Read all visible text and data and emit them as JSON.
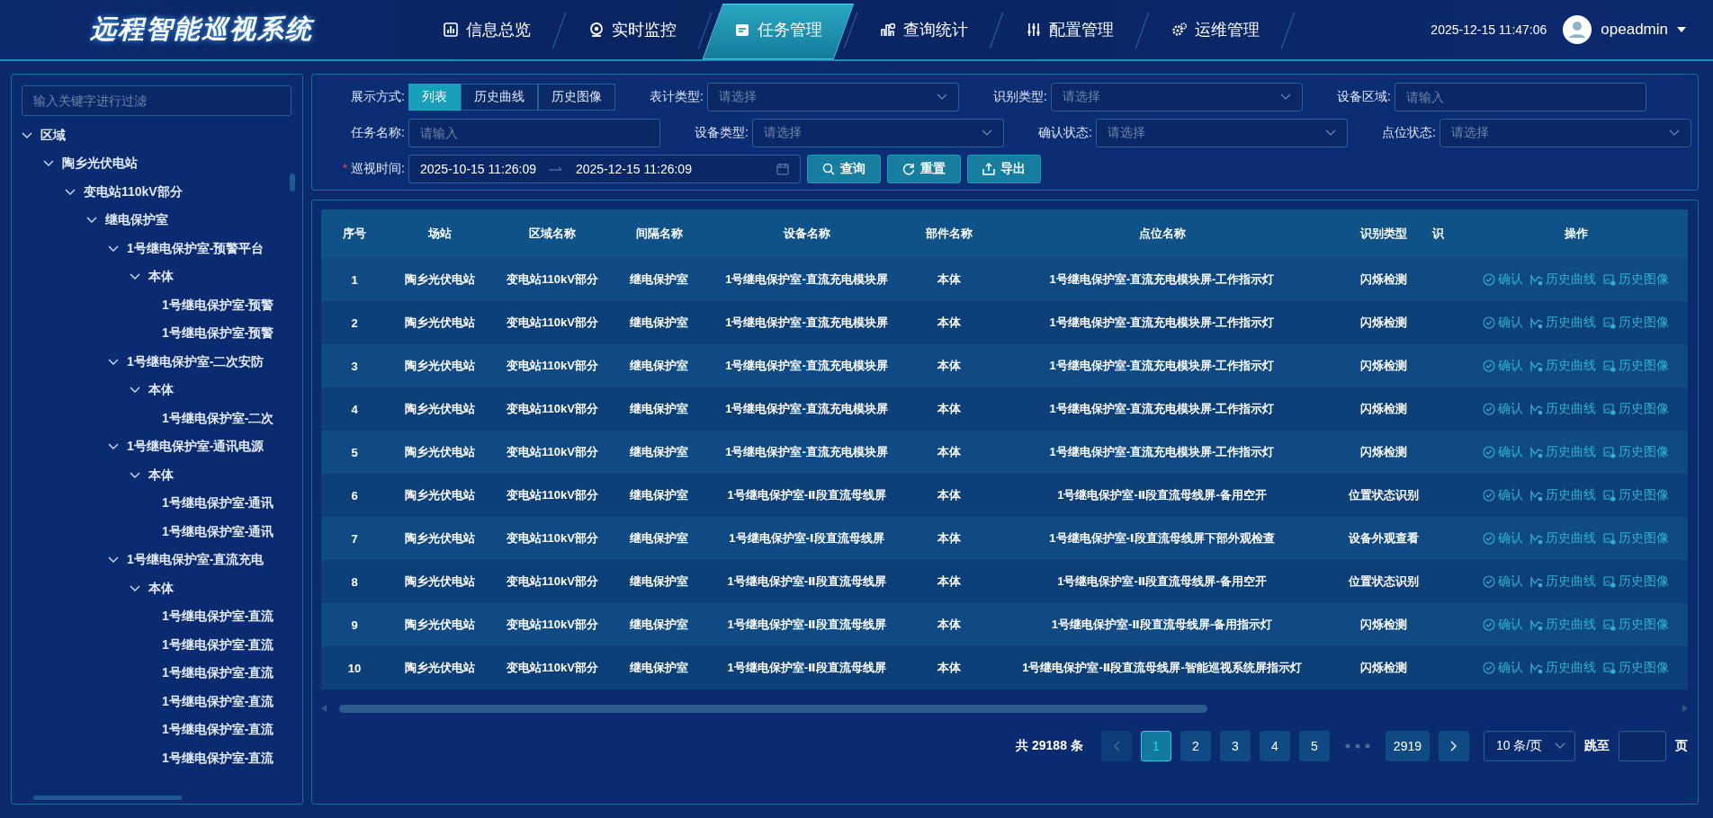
{
  "header": {
    "title": "远程智能巡视系统",
    "nav": [
      {
        "label": "信息总览",
        "selected": false
      },
      {
        "label": "实时监控",
        "selected": false
      },
      {
        "label": "任务管理",
        "selected": true
      },
      {
        "label": "查询统计",
        "selected": false
      },
      {
        "label": "配置管理",
        "selected": false
      },
      {
        "label": "运维管理",
        "selected": false
      }
    ],
    "datetime": "2025-12-15 11:47:06",
    "user": "opeadmin"
  },
  "sidebar": {
    "filter": {
      "placeholder": "输入关键字进行过滤"
    },
    "tree": [
      {
        "label": "区域",
        "expanded": true,
        "children": [
          {
            "label": "陶乡光伏电站",
            "expanded": true,
            "children": [
              {
                "label": "变电站110kV部分",
                "expanded": true,
                "children": [
                  {
                    "label": "继电保护室",
                    "expanded": true,
                    "children": [
                      {
                        "label": "1号继电保护室-预警平台",
                        "expanded": true,
                        "children": [
                          {
                            "label": "本体",
                            "expanded": true,
                            "children": [
                              {
                                "label": "1号继电保护室-预警"
                              },
                              {
                                "label": "1号继电保护室-预警"
                              }
                            ]
                          }
                        ]
                      },
                      {
                        "label": "1号继电保护室-二次安防",
                        "expanded": true,
                        "children": [
                          {
                            "label": "本体",
                            "expanded": true,
                            "children": [
                              {
                                "label": "1号继电保护室-二次"
                              }
                            ]
                          }
                        ]
                      },
                      {
                        "label": "1号继电保护室-通讯电源",
                        "expanded": true,
                        "children": [
                          {
                            "label": "本体",
                            "expanded": true,
                            "children": [
                              {
                                "label": "1号继电保护室-通讯"
                              },
                              {
                                "label": "1号继电保护室-通讯"
                              }
                            ]
                          }
                        ]
                      },
                      {
                        "label": "1号继电保护室-直流充电",
                        "expanded": true,
                        "children": [
                          {
                            "label": "本体",
                            "expanded": true,
                            "children": [
                              {
                                "label": "1号继电保护室-直流"
                              },
                              {
                                "label": "1号继电保护室-直流"
                              },
                              {
                                "label": "1号继电保护室-直流"
                              },
                              {
                                "label": "1号继电保护室-直流"
                              },
                              {
                                "label": "1号继电保护室-直流"
                              },
                              {
                                "label": "1号继电保护室-直流"
                              }
                            ]
                          }
                        ]
                      }
                    ]
                  }
                ]
              }
            ]
          }
        ]
      }
    ]
  },
  "filters": {
    "rows": [
      {
        "fields": [
          {
            "kind": "segmented",
            "label": "展示方式:",
            "options": [
              {
                "label": "列表",
                "selected": true
              },
              {
                "label": "历史曲线",
                "selected": false
              },
              {
                "label": "历史图像",
                "selected": false
              }
            ]
          },
          {
            "kind": "select",
            "label": "表计类型:",
            "placeholder": "请选择"
          },
          {
            "kind": "select",
            "label": "识别类型:",
            "placeholder": "请选择"
          },
          {
            "kind": "input",
            "label": "设备区域:",
            "placeholder": "请输入"
          }
        ]
      },
      {
        "fields": [
          {
            "kind": "input",
            "label": "任务名称:",
            "placeholder": "请输入"
          },
          {
            "kind": "select",
            "label": "设备类型:",
            "placeholder": "请选择"
          },
          {
            "kind": "select",
            "label": "确认状态:",
            "placeholder": "请选择"
          },
          {
            "kind": "select",
            "label": "点位状态:",
            "placeholder": "请选择"
          }
        ]
      },
      {
        "fields": [
          {
            "kind": "daterange",
            "label": "巡视时间:",
            "required_mark": "*",
            "start": "2025-10-15 11:26:09",
            "end": "2025-12-15 11:26:09"
          }
        ],
        "buttons": [
          "查询",
          "重置",
          "导出"
        ]
      }
    ]
  },
  "table": {
    "columns": [
      {
        "label": "序号",
        "kind": "text"
      },
      {
        "label": "场站",
        "kind": "text"
      },
      {
        "label": "区域名称",
        "kind": "text"
      },
      {
        "label": "间隔名称",
        "kind": "text"
      },
      {
        "label": "设备名称",
        "kind": "text"
      },
      {
        "label": "部件名称",
        "kind": "text"
      },
      {
        "label": "点位名称",
        "kind": "text"
      },
      {
        "label": "识别类型",
        "kind": "text"
      },
      {
        "label": "识",
        "kind": "cut"
      },
      {
        "label": "操作",
        "kind": "actions"
      }
    ],
    "rows": [
      {
        "cells": [
          "1",
          "陶乡光伏电站",
          "变电站110kV部分",
          "继电保护室",
          "1号继电保护室-直流充电模块屏",
          "本体",
          "1号继电保护室-直流充电模块屏-工作指示灯",
          "闪烁检测"
        ],
        "actions": [
          "确认",
          "历史曲线",
          "历史图像"
        ]
      },
      {
        "cells": [
          "2",
          "陶乡光伏电站",
          "变电站110kV部分",
          "继电保护室",
          "1号继电保护室-直流充电模块屏",
          "本体",
          "1号继电保护室-直流充电模块屏-工作指示灯",
          "闪烁检测"
        ],
        "actions": [
          "确认",
          "历史曲线",
          "历史图像"
        ]
      },
      {
        "cells": [
          "3",
          "陶乡光伏电站",
          "变电站110kV部分",
          "继电保护室",
          "1号继电保护室-直流充电模块屏",
          "本体",
          "1号继电保护室-直流充电模块屏-工作指示灯",
          "闪烁检测"
        ],
        "actions": [
          "确认",
          "历史曲线",
          "历史图像"
        ]
      },
      {
        "cells": [
          "4",
          "陶乡光伏电站",
          "变电站110kV部分",
          "继电保护室",
          "1号继电保护室-直流充电模块屏",
          "本体",
          "1号继电保护室-直流充电模块屏-工作指示灯",
          "闪烁检测"
        ],
        "actions": [
          "确认",
          "历史曲线",
          "历史图像"
        ]
      },
      {
        "cells": [
          "5",
          "陶乡光伏电站",
          "变电站110kV部分",
          "继电保护室",
          "1号继电保护室-直流充电模块屏",
          "本体",
          "1号继电保护室-直流充电模块屏-工作指示灯",
          "闪烁检测"
        ],
        "actions": [
          "确认",
          "历史曲线",
          "历史图像"
        ]
      },
      {
        "cells": [
          "6",
          "陶乡光伏电站",
          "变电站110kV部分",
          "继电保护室",
          "1号继电保护室-Ⅱ段直流母线屏",
          "本体",
          "1号继电保护室-Ⅱ段直流母线屏-备用空开",
          "位置状态识别"
        ],
        "actions": [
          "确认",
          "历史曲线",
          "历史图像"
        ]
      },
      {
        "cells": [
          "7",
          "陶乡光伏电站",
          "变电站110kV部分",
          "继电保护室",
          "1号继电保护室-Ⅰ段直流母线屏",
          "本体",
          "1号继电保护室-Ⅰ段直流母线屏下部外观检查",
          "设备外观查看"
        ],
        "actions": [
          "确认",
          "历史曲线",
          "历史图像"
        ]
      },
      {
        "cells": [
          "8",
          "陶乡光伏电站",
          "变电站110kV部分",
          "继电保护室",
          "1号继电保护室-Ⅱ段直流母线屏",
          "本体",
          "1号继电保护室-Ⅱ段直流母线屏-备用空开",
          "位置状态识别"
        ],
        "actions": [
          "确认",
          "历史曲线",
          "历史图像"
        ]
      },
      {
        "cells": [
          "9",
          "陶乡光伏电站",
          "变电站110kV部分",
          "继电保护室",
          "1号继电保护室-Ⅱ段直流母线屏",
          "本体",
          "1号继电保护室-Ⅱ段直流母线屏-备用指示灯",
          "闪烁检测"
        ],
        "actions": [
          "确认",
          "历史曲线",
          "历史图像"
        ]
      },
      {
        "cells": [
          "10",
          "陶乡光伏电站",
          "变电站110kV部分",
          "继电保护室",
          "1号继电保护室-Ⅱ段直流母线屏",
          "本体",
          "1号继电保护室-Ⅱ段直流母线屏-智能巡视系统屏指示灯",
          "闪烁检测"
        ],
        "actions": [
          "确认",
          "历史曲线",
          "历史图像"
        ]
      }
    ]
  },
  "pagination": {
    "total": "共 29188 条",
    "prev": {
      "disabled": true
    },
    "next": {
      "disabled": false
    },
    "pages": [
      {
        "kind": "page",
        "label": "1",
        "selected": true
      },
      {
        "kind": "page",
        "label": "2",
        "selected": false
      },
      {
        "kind": "page",
        "label": "3",
        "selected": false
      },
      {
        "kind": "page",
        "label": "4",
        "selected": false
      },
      {
        "kind": "page",
        "label": "5",
        "selected": false
      },
      {
        "kind": "ellipsis"
      },
      {
        "kind": "page",
        "label": "2919",
        "selected": false
      }
    ],
    "page_size": "10 条/页",
    "jump_label": "跳至",
    "page_suffix": "页"
  }
}
